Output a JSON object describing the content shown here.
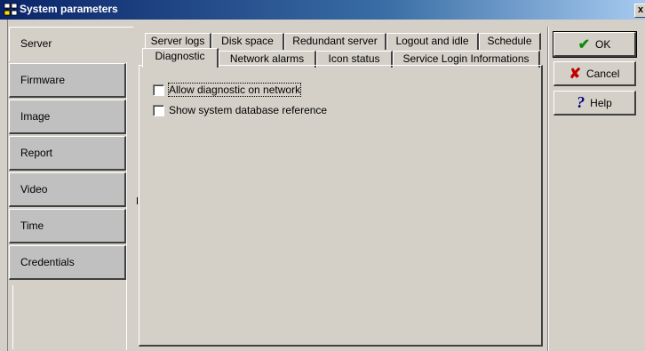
{
  "window": {
    "title": "System parameters",
    "close_glyph": "x"
  },
  "left_tabs": [
    {
      "label": "Server",
      "active": true
    },
    {
      "label": "Firmware"
    },
    {
      "label": "Image"
    },
    {
      "label": "Report"
    },
    {
      "label": "Video"
    },
    {
      "label": "Time"
    },
    {
      "label": "Credentials"
    }
  ],
  "tabs_row1": [
    "Server logs",
    "Disk space",
    "Redundant server",
    "Logout and idle",
    "Schedule"
  ],
  "tabs_row2": [
    "Diagnostic",
    "Network alarms",
    "Icon status",
    "Service Login Informations"
  ],
  "active_tab": "Diagnostic",
  "options": [
    {
      "label": "Allow diagnostic on network",
      "checked": false
    },
    {
      "label": "Show system database reference",
      "checked": false
    }
  ],
  "buttons": {
    "ok": {
      "label": "OK",
      "icon": "checkmark-icon"
    },
    "cancel": {
      "label": "Cancel",
      "icon": "x-icon"
    },
    "help": {
      "label": "Help",
      "icon": "question-icon"
    }
  },
  "colors": {
    "ok_icon": "#0a8a0a",
    "cancel_icon": "#c00000",
    "help_icon": "#000080"
  }
}
